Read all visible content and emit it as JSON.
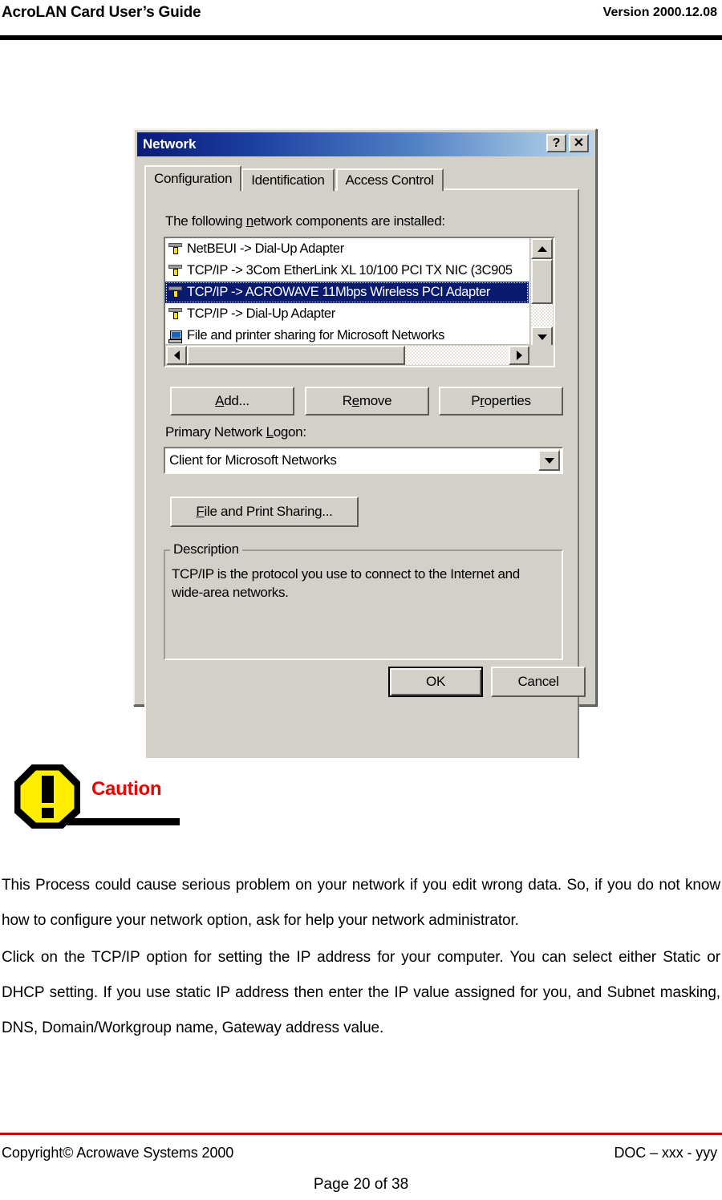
{
  "header": {
    "title": "AcroLAN Card User’s Guide",
    "version": "Version 2000.12.08"
  },
  "dialog": {
    "title": "Network",
    "titlebar_buttons": [
      {
        "name": "help-button",
        "glyph": "?"
      },
      {
        "name": "close-button",
        "glyph": "✕"
      }
    ],
    "tabs": [
      {
        "label": "Configuration",
        "active": true
      },
      {
        "label": "Identification",
        "active": false
      },
      {
        "label": "Access Control",
        "active": false
      }
    ],
    "components_label_pre": "The following ",
    "components_label_accel": "n",
    "components_label_post": "etwork components are installed:",
    "components": [
      {
        "icon": "protocol-icon",
        "label": "NetBEUI -> Dial-Up Adapter",
        "selected": false
      },
      {
        "icon": "protocol-icon",
        "label": "TCP/IP -> 3Com EtherLink XL 10/100 PCI TX NIC (3C905",
        "selected": false
      },
      {
        "icon": "protocol-icon",
        "label": "TCP/IP -> ACROWAVE 11Mbps Wireless PCI Adapter",
        "selected": true
      },
      {
        "icon": "protocol-icon",
        "label": "TCP/IP -> Dial-Up Adapter",
        "selected": false
      },
      {
        "icon": "computer-icon",
        "label": "File and printer sharing for Microsoft Networks",
        "selected": false
      }
    ],
    "buttons": {
      "add": {
        "pre": "",
        "accel": "A",
        "post": "dd..."
      },
      "remove": {
        "pre": "R",
        "accel": "e",
        "post": "move"
      },
      "properties": {
        "pre": "P",
        "accel": "r",
        "post": "operties"
      },
      "file_print_sharing": {
        "pre": "",
        "accel": "F",
        "post": "ile and Print Sharing..."
      },
      "ok": "OK",
      "cancel": "Cancel"
    },
    "logon": {
      "label_pre": "Primary Network ",
      "label_accel": "L",
      "label_post": "ogon:",
      "value": "Client for Microsoft Networks"
    },
    "description": {
      "legend": "Description",
      "text": "TCP/IP is the protocol you use to connect to the Internet and wide-area networks."
    }
  },
  "caution": {
    "label": "Caution",
    "icon": "warning-octagon-icon",
    "icon_fill": "#ffee00",
    "label_color": "#ee0000"
  },
  "body": {
    "paragraph_1": "This Process could cause serious problem on your network if you edit wrong data. So, if you do not know how to configure your network option, ask for help your network administrator.",
    "paragraph_2": "Click on the TCP/IP option for setting the IP address for your computer. You can select either Static or DHCP setting. If you use static IP address then enter the IP value assigned for you, and Subnet masking, DNS, Domain/Workgroup name, Gateway address value."
  },
  "footer": {
    "copyright": "Copyright© Acrowave Systems 2000",
    "doc": "DOC – xxx - yyy",
    "page": "Page 20 of 38",
    "rule_color": "#cc0000"
  }
}
